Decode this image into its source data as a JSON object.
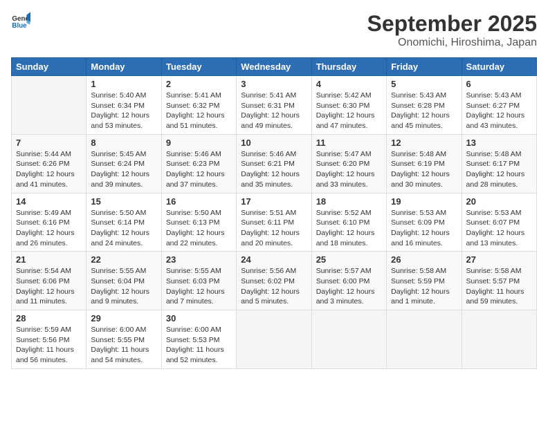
{
  "header": {
    "logo_general": "General",
    "logo_blue": "Blue",
    "month": "September 2025",
    "location": "Onomichi, Hiroshima, Japan"
  },
  "weekdays": [
    "Sunday",
    "Monday",
    "Tuesday",
    "Wednesday",
    "Thursday",
    "Friday",
    "Saturday"
  ],
  "weeks": [
    [
      {
        "day": "",
        "info": ""
      },
      {
        "day": "1",
        "info": "Sunrise: 5:40 AM\nSunset: 6:34 PM\nDaylight: 12 hours\nand 53 minutes."
      },
      {
        "day": "2",
        "info": "Sunrise: 5:41 AM\nSunset: 6:32 PM\nDaylight: 12 hours\nand 51 minutes."
      },
      {
        "day": "3",
        "info": "Sunrise: 5:41 AM\nSunset: 6:31 PM\nDaylight: 12 hours\nand 49 minutes."
      },
      {
        "day": "4",
        "info": "Sunrise: 5:42 AM\nSunset: 6:30 PM\nDaylight: 12 hours\nand 47 minutes."
      },
      {
        "day": "5",
        "info": "Sunrise: 5:43 AM\nSunset: 6:28 PM\nDaylight: 12 hours\nand 45 minutes."
      },
      {
        "day": "6",
        "info": "Sunrise: 5:43 AM\nSunset: 6:27 PM\nDaylight: 12 hours\nand 43 minutes."
      }
    ],
    [
      {
        "day": "7",
        "info": "Sunrise: 5:44 AM\nSunset: 6:26 PM\nDaylight: 12 hours\nand 41 minutes."
      },
      {
        "day": "8",
        "info": "Sunrise: 5:45 AM\nSunset: 6:24 PM\nDaylight: 12 hours\nand 39 minutes."
      },
      {
        "day": "9",
        "info": "Sunrise: 5:46 AM\nSunset: 6:23 PM\nDaylight: 12 hours\nand 37 minutes."
      },
      {
        "day": "10",
        "info": "Sunrise: 5:46 AM\nSunset: 6:21 PM\nDaylight: 12 hours\nand 35 minutes."
      },
      {
        "day": "11",
        "info": "Sunrise: 5:47 AM\nSunset: 6:20 PM\nDaylight: 12 hours\nand 33 minutes."
      },
      {
        "day": "12",
        "info": "Sunrise: 5:48 AM\nSunset: 6:19 PM\nDaylight: 12 hours\nand 30 minutes."
      },
      {
        "day": "13",
        "info": "Sunrise: 5:48 AM\nSunset: 6:17 PM\nDaylight: 12 hours\nand 28 minutes."
      }
    ],
    [
      {
        "day": "14",
        "info": "Sunrise: 5:49 AM\nSunset: 6:16 PM\nDaylight: 12 hours\nand 26 minutes."
      },
      {
        "day": "15",
        "info": "Sunrise: 5:50 AM\nSunset: 6:14 PM\nDaylight: 12 hours\nand 24 minutes."
      },
      {
        "day": "16",
        "info": "Sunrise: 5:50 AM\nSunset: 6:13 PM\nDaylight: 12 hours\nand 22 minutes."
      },
      {
        "day": "17",
        "info": "Sunrise: 5:51 AM\nSunset: 6:11 PM\nDaylight: 12 hours\nand 20 minutes."
      },
      {
        "day": "18",
        "info": "Sunrise: 5:52 AM\nSunset: 6:10 PM\nDaylight: 12 hours\nand 18 minutes."
      },
      {
        "day": "19",
        "info": "Sunrise: 5:53 AM\nSunset: 6:09 PM\nDaylight: 12 hours\nand 16 minutes."
      },
      {
        "day": "20",
        "info": "Sunrise: 5:53 AM\nSunset: 6:07 PM\nDaylight: 12 hours\nand 13 minutes."
      }
    ],
    [
      {
        "day": "21",
        "info": "Sunrise: 5:54 AM\nSunset: 6:06 PM\nDaylight: 12 hours\nand 11 minutes."
      },
      {
        "day": "22",
        "info": "Sunrise: 5:55 AM\nSunset: 6:04 PM\nDaylight: 12 hours\nand 9 minutes."
      },
      {
        "day": "23",
        "info": "Sunrise: 5:55 AM\nSunset: 6:03 PM\nDaylight: 12 hours\nand 7 minutes."
      },
      {
        "day": "24",
        "info": "Sunrise: 5:56 AM\nSunset: 6:02 PM\nDaylight: 12 hours\nand 5 minutes."
      },
      {
        "day": "25",
        "info": "Sunrise: 5:57 AM\nSunset: 6:00 PM\nDaylight: 12 hours\nand 3 minutes."
      },
      {
        "day": "26",
        "info": "Sunrise: 5:58 AM\nSunset: 5:59 PM\nDaylight: 12 hours\nand 1 minute."
      },
      {
        "day": "27",
        "info": "Sunrise: 5:58 AM\nSunset: 5:57 PM\nDaylight: 11 hours\nand 59 minutes."
      }
    ],
    [
      {
        "day": "28",
        "info": "Sunrise: 5:59 AM\nSunset: 5:56 PM\nDaylight: 11 hours\nand 56 minutes."
      },
      {
        "day": "29",
        "info": "Sunrise: 6:00 AM\nSunset: 5:55 PM\nDaylight: 11 hours\nand 54 minutes."
      },
      {
        "day": "30",
        "info": "Sunrise: 6:00 AM\nSunset: 5:53 PM\nDaylight: 11 hours\nand 52 minutes."
      },
      {
        "day": "",
        "info": ""
      },
      {
        "day": "",
        "info": ""
      },
      {
        "day": "",
        "info": ""
      },
      {
        "day": "",
        "info": ""
      }
    ]
  ]
}
